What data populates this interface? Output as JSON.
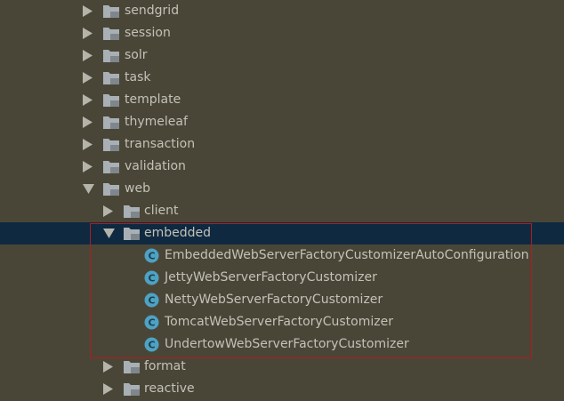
{
  "tree": {
    "nodes": [
      {
        "label": "sendgrid",
        "kind": "folder",
        "expanded": false
      },
      {
        "label": "session",
        "kind": "folder",
        "expanded": false
      },
      {
        "label": "solr",
        "kind": "folder",
        "expanded": false
      },
      {
        "label": "task",
        "kind": "folder",
        "expanded": false
      },
      {
        "label": "template",
        "kind": "folder",
        "expanded": false
      },
      {
        "label": "thymeleaf",
        "kind": "folder",
        "expanded": false
      },
      {
        "label": "transaction",
        "kind": "folder",
        "expanded": false
      },
      {
        "label": "validation",
        "kind": "folder",
        "expanded": false
      },
      {
        "label": "web",
        "kind": "folder",
        "expanded": true
      },
      {
        "label": "client",
        "kind": "folder",
        "expanded": false
      },
      {
        "label": "embedded",
        "kind": "folder",
        "expanded": true,
        "selected": true
      },
      {
        "label": "EmbeddedWebServerFactoryCustomizerAutoConfiguration",
        "kind": "class"
      },
      {
        "label": "JettyWebServerFactoryCustomizer",
        "kind": "class"
      },
      {
        "label": "NettyWebServerFactoryCustomizer",
        "kind": "class"
      },
      {
        "label": "TomcatWebServerFactoryCustomizer",
        "kind": "class"
      },
      {
        "label": "UndertowWebServerFactoryCustomizer",
        "kind": "class"
      },
      {
        "label": "format",
        "kind": "folder",
        "expanded": false
      },
      {
        "label": "reactive",
        "kind": "folder",
        "expanded": false
      }
    ]
  },
  "colors": {
    "background": "#4a4637",
    "text": "#c3c2b8",
    "selection": "#0f2a40",
    "highlight_border": "#b01c1c",
    "folder": "#a9b0b5",
    "class_icon": "#4ea2c4"
  },
  "icons": {
    "folder": "folder-icon",
    "class": "java-class-icon",
    "collapsed": "expand-arrow-icon",
    "expanded": "collapse-arrow-icon"
  }
}
